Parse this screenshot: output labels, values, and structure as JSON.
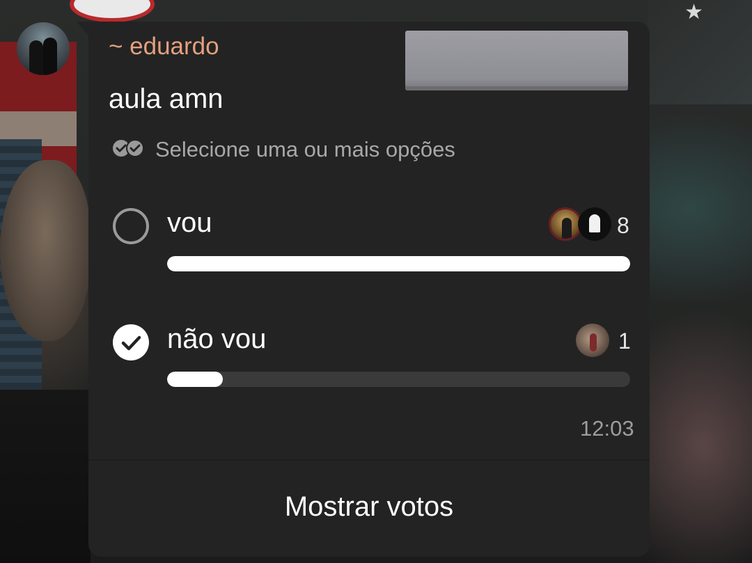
{
  "message": {
    "sender": "~ eduardo",
    "time": "12:03"
  },
  "poll": {
    "title": "aula amn",
    "hint": "Selecione uma ou mais opções",
    "hint_icon": "double-check-icon",
    "options": [
      {
        "label": "vou",
        "votes": "8",
        "selected": false,
        "fill_fraction": 1.0,
        "voter_avatars": [
          "voter-avatar-photo",
          "voter-avatar-ghost"
        ]
      },
      {
        "label": "não vou",
        "votes": "1",
        "selected": true,
        "fill_fraction": 0.12,
        "voter_avatars": [
          "voter-avatar-photo"
        ]
      }
    ],
    "show_votes_label": "Mostrar votos"
  },
  "colors": {
    "bubble": "#232323",
    "sender_name": "#e3a07f",
    "bar_fill": "#ffffff",
    "bar_track": "#3a3a3a",
    "secondary_text": "#a8a8a8"
  }
}
